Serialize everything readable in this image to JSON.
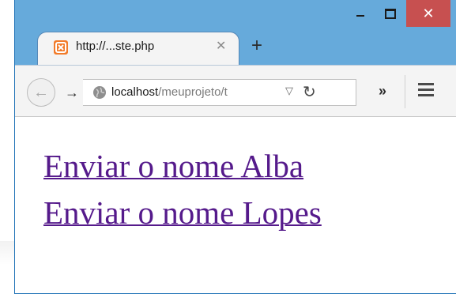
{
  "window": {
    "minimize_icon": "minimize-icon",
    "maximize_icon": "maximize-icon",
    "close_glyph": "✕",
    "accent_titlebar": "#66aadb",
    "close_color": "#c75050"
  },
  "tab": {
    "favicon": "xampp-icon",
    "title": "http://...ste.php",
    "close_glyph": "✕",
    "new_tab_glyph": "+"
  },
  "toolbar": {
    "back_glyph": "←",
    "forward_glyph": "→",
    "url_host": "localhost",
    "url_path": "/meuprojeto/t",
    "dropdown_glyph": "▽",
    "reload_glyph": "↻",
    "overflow_glyph": "»",
    "menu_icon": "hamburger-icon"
  },
  "content": {
    "links": [
      {
        "label": "Enviar o nome Alba"
      },
      {
        "label": "Enviar o nome Lopes"
      }
    ],
    "link_color": "#551a8b"
  }
}
